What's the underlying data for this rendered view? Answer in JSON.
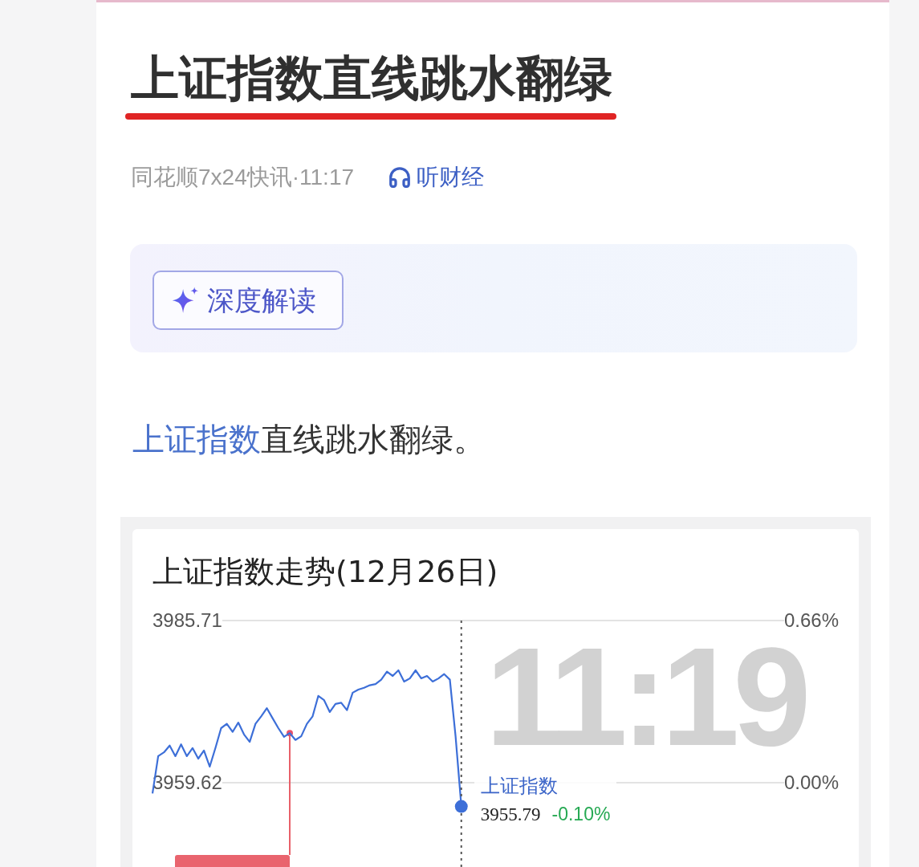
{
  "article": {
    "title": "上证指数直线跳水翻绿",
    "source": "同花顺7x24快讯·11:17",
    "listen_label": "听财经"
  },
  "insight_button": {
    "label": "深度解读"
  },
  "body": {
    "link": "上证指数",
    "text": "直线跳水翻绿。"
  },
  "chart": {
    "chart_data": {
      "type": "line",
      "title": "上证指数走势(12月26日)",
      "categories": [
        null,
        null,
        null,
        null,
        null,
        null,
        null,
        null,
        null,
        null,
        null,
        null,
        null,
        null,
        null,
        null,
        null,
        null,
        null,
        null,
        null,
        null,
        null,
        null,
        null,
        null,
        null,
        null,
        null,
        null,
        null,
        null,
        null,
        null,
        null,
        null,
        null,
        null,
        null,
        null,
        null,
        null,
        null,
        null,
        null,
        null,
        null,
        null,
        null,
        null,
        null,
        null,
        null,
        null,
        null,
        null,
        null,
        null,
        null,
        null,
        null,
        null,
        null,
        null,
        null,
        null,
        null,
        null,
        null,
        null,
        null,
        null,
        null,
        null,
        null,
        null,
        null,
        null,
        null,
        null,
        null,
        null,
        null,
        null,
        null,
        null,
        null,
        null,
        null,
        null,
        null,
        null,
        null,
        null,
        null,
        null,
        null,
        null,
        null,
        null,
        null,
        null,
        null,
        null,
        null,
        null,
        null,
        null,
        null,
        null,
        null,
        null,
        null,
        null,
        null,
        null,
        null,
        null,
        null,
        null,
        null
      ],
      "ylim": [
        3933.53,
        3985.71
      ],
      "yticks": [
        {
          "value": 3985.71,
          "label": "3985.71"
        },
        {
          "value": 3959.62,
          "label": "3959.62"
        }
      ],
      "series": [
        {
          "name": "上证指数",
          "color": "#3d6fd8",
          "values": [
            3957.9,
            3963.9,
            3964.5,
            3965.6,
            3963.9,
            3965.8,
            3963.9,
            3965.2,
            3963.5,
            3964.8,
            3962.2,
            3965.2,
            3968.4,
            3969.1,
            3967.8,
            3969.3,
            3967.4,
            3966.2,
            3969.1,
            3970.3,
            3971.6,
            3970.0,
            3968.4,
            3967.0,
            3967.6,
            3966.5,
            3967.1,
            3969.1,
            3970.3,
            3973.6,
            3972.9,
            3971.0,
            3972.3,
            3972.5,
            3971.3,
            3974.1,
            3974.6,
            3974.9,
            3975.3,
            3975.5,
            3976.2,
            3977.5,
            3976.8,
            3977.7,
            3975.9,
            3976.4,
            3977.7,
            3976.4,
            3976.8,
            3975.9,
            3976.4,
            3977.1,
            3976.2,
            3967.1,
            3955.8,
            null,
            null,
            null,
            null,
            null,
            null,
            null,
            null,
            null,
            null,
            null,
            null,
            null,
            null,
            null,
            null,
            null,
            null,
            null,
            null,
            null,
            null,
            null,
            null,
            null,
            null,
            null,
            null,
            null,
            null,
            null,
            null,
            null,
            null,
            null,
            null,
            null,
            null,
            null,
            null,
            null,
            null,
            null,
            null,
            null,
            null,
            null,
            null,
            null,
            null,
            null,
            null,
            null,
            null,
            null,
            null,
            null,
            null,
            null,
            null,
            null,
            null,
            null,
            null,
            null,
            null
          ]
        }
      ]
    },
    "crosshair_time": "11:19",
    "right_axis_labels": [
      "0.66%",
      "0.00%"
    ],
    "tooltip": {
      "value": "3955.79",
      "change": "-0.10%"
    }
  }
}
